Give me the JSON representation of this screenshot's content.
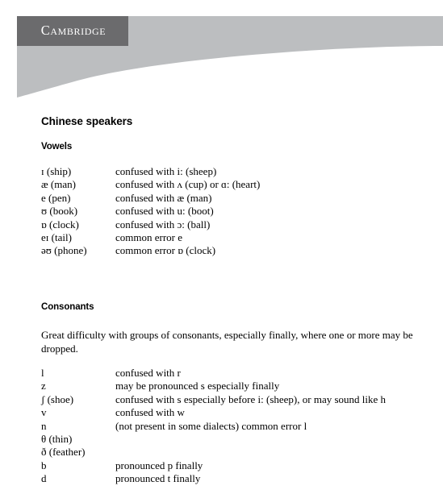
{
  "header": {
    "logo_text": "Cambridge",
    "logo_box_color": "#6b6b6d",
    "band_color": "#bcbec0"
  },
  "document": {
    "title": "Chinese speakers",
    "sections": [
      {
        "heading": "Vowels",
        "entries": [
          {
            "symbol": "ɪ (ship)",
            "description": "confused with i: (sheep)"
          },
          {
            "symbol": "æ (man)",
            "description": "confused with ʌ (cup) or ɑ: (heart)"
          },
          {
            "symbol": "e (pen)",
            "description": "confused with æ (man)"
          },
          {
            "symbol": "ʊ (book)",
            "description": "confused with u: (boot)"
          },
          {
            "symbol": "ɒ (clock)",
            "description": "confused with ɔ: (ball)"
          },
          {
            "symbol": "eɪ (tail)",
            "description": "common error e"
          },
          {
            "symbol": "əʊ (phone)",
            "description": "common error ɒ (clock)"
          }
        ]
      },
      {
        "heading": "Consonants",
        "intro": "Great difficulty with groups of consonants, especially finally, where one or more may be dropped.",
        "entries": [
          {
            "symbol": "l",
            "description": "confused with r"
          },
          {
            "symbol": "z",
            "description": "may be pronounced s especially finally"
          },
          {
            "symbol": "ʃ (shoe)",
            "description": "confused with s especially before i: (sheep), or may sound like h"
          },
          {
            "symbol": "v",
            "description": "confused with w"
          },
          {
            "symbol": "n",
            "description": "(not present in some dialects) common error l"
          },
          {
            "symbol": "θ (thin)",
            "description": ""
          },
          {
            "symbol": "ð (feather)",
            "description": ""
          },
          {
            "symbol": "b",
            "description": "pronounced p finally"
          },
          {
            "symbol": "d",
            "description": "pronounced t finally"
          }
        ]
      }
    ]
  }
}
